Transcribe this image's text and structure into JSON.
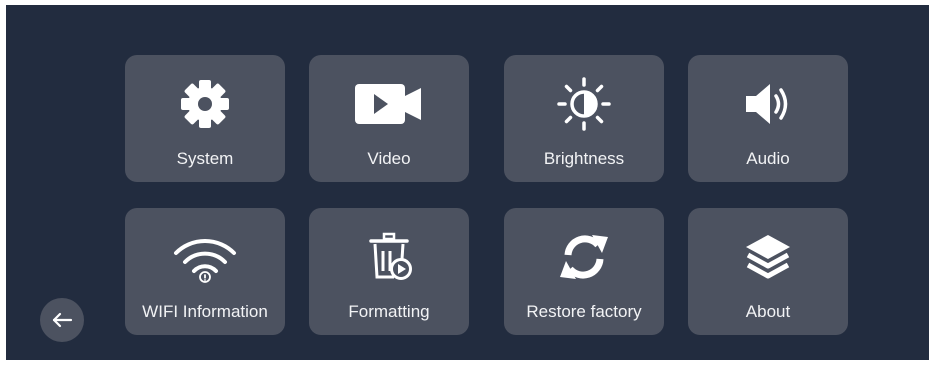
{
  "menu": {
    "items": [
      {
        "label": "System",
        "icon": "gear-icon"
      },
      {
        "label": "Video",
        "icon": "video-camera-icon"
      },
      {
        "label": "Brightness",
        "icon": "brightness-icon"
      },
      {
        "label": "Audio",
        "icon": "speaker-icon"
      },
      {
        "label": "WIFI Information",
        "icon": "wifi-info-icon"
      },
      {
        "label": "Formatting",
        "icon": "trash-format-icon"
      },
      {
        "label": "Restore factory",
        "icon": "refresh-icon"
      },
      {
        "label": "About",
        "icon": "layers-icon"
      }
    ]
  },
  "back": {
    "icon": "arrow-left-icon"
  },
  "colors": {
    "background": "#222c3f",
    "tile": "#4c5260",
    "text": "#f2f3f5"
  }
}
